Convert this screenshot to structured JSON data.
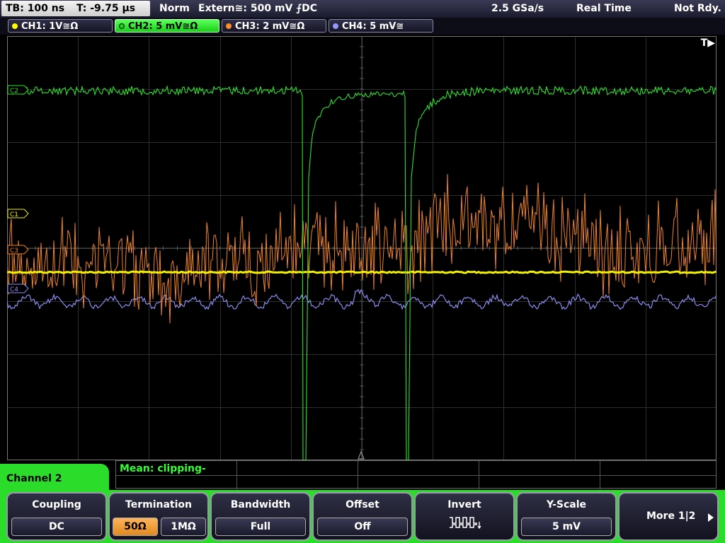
{
  "status": {
    "timebase": "TB: 100 ns",
    "trigger_offset": "T: -9.75 µs",
    "mode": "Norm",
    "trigger_source": "Extern≅: 500 mV ⨍DC",
    "sample_rate": "2.5 GSa/s",
    "acq_mode": "Real Time",
    "state": "Not Rdy."
  },
  "channels": [
    {
      "label": "CH1: 1V≅Ω",
      "color": "#ffff00",
      "active": false
    },
    {
      "label": "CH2: 5 mV≅Ω",
      "color": "#32e632",
      "active": true
    },
    {
      "label": "CH3: 2 mV≅Ω",
      "color": "#ff8c28",
      "active": false
    },
    {
      "label": "CH4: 5 mV≅",
      "color": "#9696ff",
      "active": false
    }
  ],
  "markers": {
    "c1": "C1",
    "c2": "C2",
    "c3": "C3",
    "c4": "C4",
    "trigger": "T▶"
  },
  "measurement": {
    "label": "Mean: clipping-"
  },
  "panel": {
    "title": "Channel 2"
  },
  "softkeys": {
    "coupling": {
      "title": "Coupling",
      "value": "DC"
    },
    "termination": {
      "title": "Termination",
      "opt1": "50Ω",
      "opt2": "1MΩ",
      "selected": "50Ω"
    },
    "bandwidth": {
      "title": "Bandwidth",
      "value": "Full"
    },
    "offset": {
      "title": "Offset",
      "value": "Off"
    },
    "invert": {
      "title": "Invert",
      "icon": "inverted-square-wave-icon"
    },
    "yscale": {
      "title": "Y-Scale",
      "value": "5 mV"
    },
    "more": {
      "label": "More 1|2"
    }
  }
}
